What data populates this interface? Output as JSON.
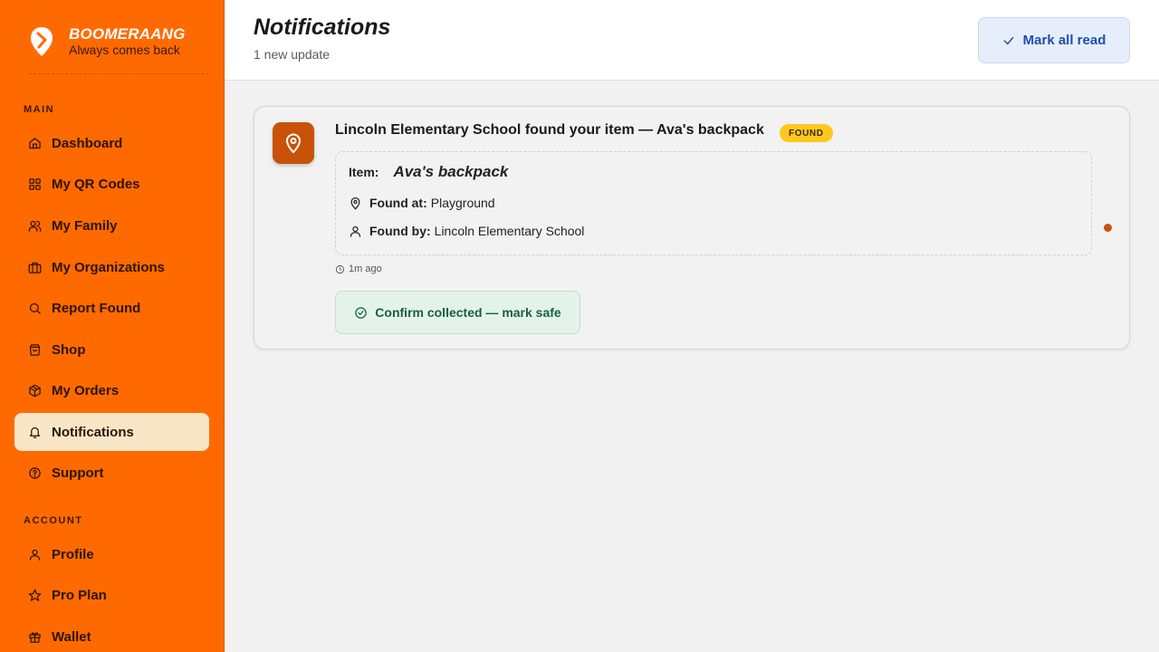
{
  "brand": {
    "name": "BOOMERAANG",
    "tagline": "Always comes back"
  },
  "sidebar": {
    "main_label": "MAIN",
    "account_label": "ACCOUNT",
    "main_items": [
      {
        "label": "Dashboard",
        "icon": "home-icon"
      },
      {
        "label": "My QR Codes",
        "icon": "qr-grid-icon"
      },
      {
        "label": "My Family",
        "icon": "users-icon"
      },
      {
        "label": "My Organizations",
        "icon": "briefcase-icon"
      },
      {
        "label": "Report Found",
        "icon": "search-icon"
      },
      {
        "label": "Shop",
        "icon": "shopping-bag-icon"
      },
      {
        "label": "My Orders",
        "icon": "package-icon"
      },
      {
        "label": "Notifications",
        "icon": "bell-icon",
        "active": true
      },
      {
        "label": "Support",
        "icon": "help-circle-icon"
      }
    ],
    "account_items": [
      {
        "label": "Profile",
        "icon": "user-icon"
      },
      {
        "label": "Pro Plan",
        "icon": "star-icon"
      },
      {
        "label": "Wallet",
        "icon": "gift-icon"
      }
    ]
  },
  "header": {
    "title": "Notifications",
    "subtitle": "1 new update",
    "mark_all_read": "Mark all read"
  },
  "notification": {
    "title": "Lincoln Elementary School found your item — Ava's backpack",
    "badge": "FOUND",
    "item_label": "Item:",
    "item_name": "Ava's backpack",
    "found_at_label": "Found at:",
    "found_at_value": "Playground",
    "found_by_label": "Found by:",
    "found_by_value": "Lincoln Elementary School",
    "time": "1m ago",
    "confirm_label": "Confirm collected — mark safe",
    "unread": true
  },
  "colors": {
    "sidebar_bg": "#ff6a00",
    "active_nav_bg": "#f9e6c7",
    "accent_icon_bg": "#c85208",
    "badge_bg": "#ffc81e",
    "primary_blue": "#1e4fb0",
    "success_green": "#17613a"
  }
}
